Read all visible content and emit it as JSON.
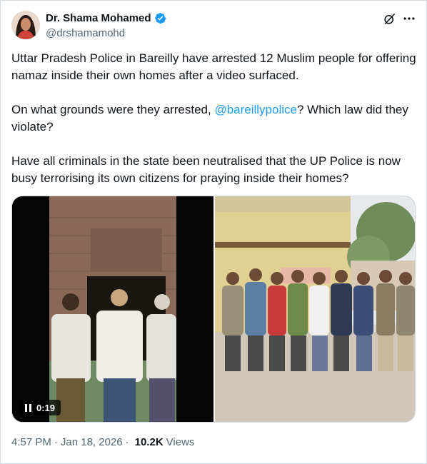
{
  "author": {
    "display_name": "Dr. Shama Mohamed",
    "handle": "@drshamamohd"
  },
  "icons": {
    "verified": "verified-badge-icon",
    "grok": "grok-icon",
    "more": "more-options-icon",
    "pause": "pause-icon"
  },
  "colors": {
    "accent": "#1d9bf0",
    "secondary_text": "#536471"
  },
  "tweet": {
    "para1": "Uttar Pradesh Police in Bareilly have arrested 12 Muslim people for offering namaz inside their own homes after a video surfaced.",
    "para2_before": "On what grounds were they arrested, ",
    "para2_mention": "@bareillypolice",
    "para2_after": "? Which law did they violate?",
    "para3": "Have all criminals in the state been neutralised that the UP Police is now busy terrorising its own citizens for praying inside their homes?"
  },
  "media": {
    "video_time": "0:19"
  },
  "footer": {
    "time": "4:57 PM",
    "date": "Jan 18, 2026",
    "views_count": "10.2K",
    "views_label": "Views"
  }
}
